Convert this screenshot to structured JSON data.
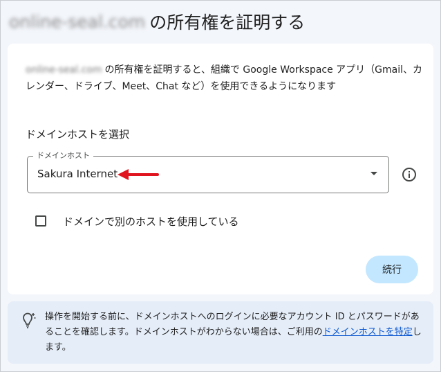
{
  "page": {
    "title_domain": "online-seal.com",
    "title_rest": "の所有権を証明する"
  },
  "intro": {
    "domain": "online-seal.com",
    "text": "の所有権を証明すると、組織で Google Workspace アプリ（Gmail、カレンダー、ドライブ、Meet、Chat など）を使用できるようになります"
  },
  "host": {
    "section_label": "ドメインホストを選択",
    "select_label": "ドメインホスト",
    "selected_value": "Sakura Internet",
    "other_host_label": "ドメインで別のホストを使用している",
    "other_host_checked": false
  },
  "actions": {
    "continue_label": "続行"
  },
  "hint": {
    "text_before": "操作を開始する前に、ドメインホストへのログインに必要なアカウント ID とパスワードがあることを確認します。ドメインホストがわからない場合は、ご利用の",
    "link_text": "ドメインホストを特定",
    "text_after": "します。"
  },
  "icons": {
    "info": "info-icon",
    "dropdown": "chevron-down-icon",
    "hint": "lightbulb-icon",
    "annotation": "red-arrow-icon"
  },
  "colors": {
    "accent_button": "#c2e7ff",
    "link": "#0b57d0",
    "hint_background": "#e5edf8",
    "annotation_arrow": "#e0141e"
  }
}
